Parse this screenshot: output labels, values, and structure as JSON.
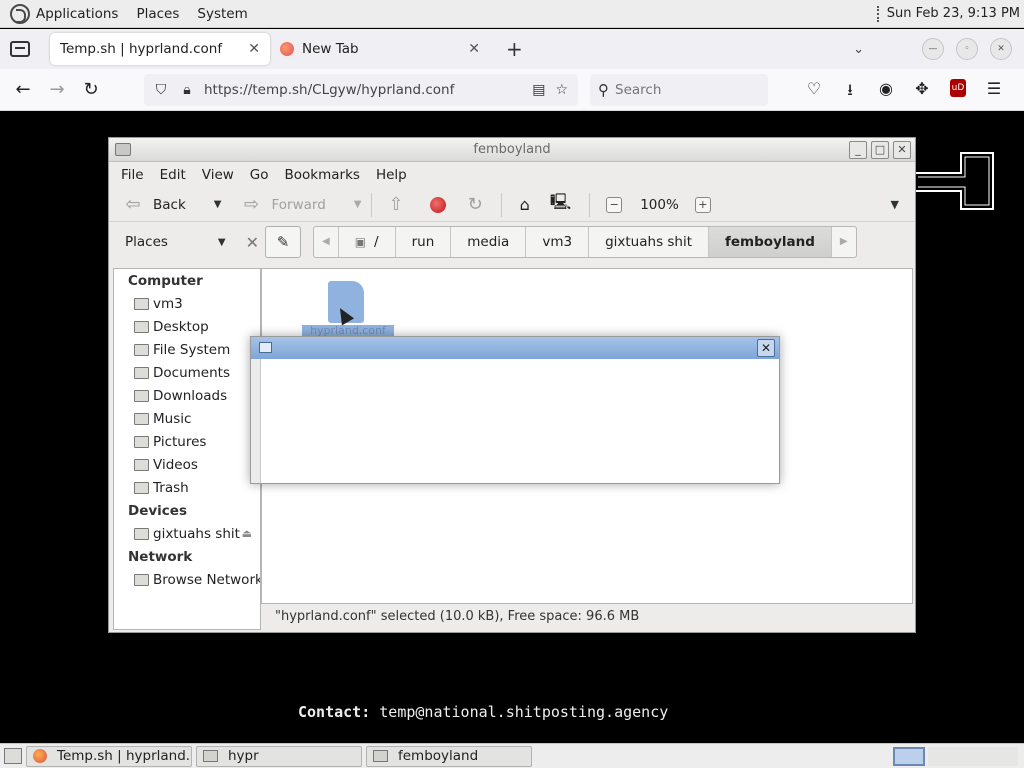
{
  "top_panel": {
    "menus": [
      "Applications",
      "Places",
      "System"
    ],
    "clock": "Sun Feb 23,  9:13 PM"
  },
  "browser": {
    "tabs": [
      {
        "label": "Temp.sh | hyprland.conf",
        "active": true
      },
      {
        "label": "New Tab",
        "active": false
      }
    ],
    "url": "https://temp.sh/CLgyw/hyprland.conf",
    "url_host_emphasis": "temp.sh",
    "search_placeholder": "Search"
  },
  "page": {
    "contact_label": "Contact:",
    "contact_value": " temp@national.shitposting.agency"
  },
  "file_manager": {
    "title": "femboyland",
    "menu": [
      "File",
      "Edit",
      "View",
      "Go",
      "Bookmarks",
      "Help"
    ],
    "toolbar": {
      "back": "Back",
      "forward": "Forward",
      "zoom": "100%"
    },
    "places_label": "Places",
    "breadcrumbs": [
      "/",
      "run",
      "media",
      "vm3",
      "gixtuahs shit",
      "femboyland"
    ],
    "sidebar": {
      "computer_header": "Computer",
      "computer_items": [
        "vm3",
        "Desktop",
        "File System",
        "Documents",
        "Downloads",
        "Music",
        "Pictures",
        "Videos",
        "Trash"
      ],
      "devices_header": "Devices",
      "devices_items": [
        "gixtuahs shit"
      ],
      "network_header": "Network",
      "network_items": [
        "Browse Network"
      ]
    },
    "files": [
      {
        "name": "hyprland.conf",
        "selected": true
      }
    ],
    "status": "\"hyprland.conf\" selected (10.0 kB), Free space: 96.6 MB"
  },
  "taskbar": {
    "tasks": [
      "Temp.sh | hyprland....",
      "hypr",
      "femboyland"
    ]
  },
  "colors": {
    "dialog_title": "#8fb0de",
    "selection": "#8fb2de"
  }
}
